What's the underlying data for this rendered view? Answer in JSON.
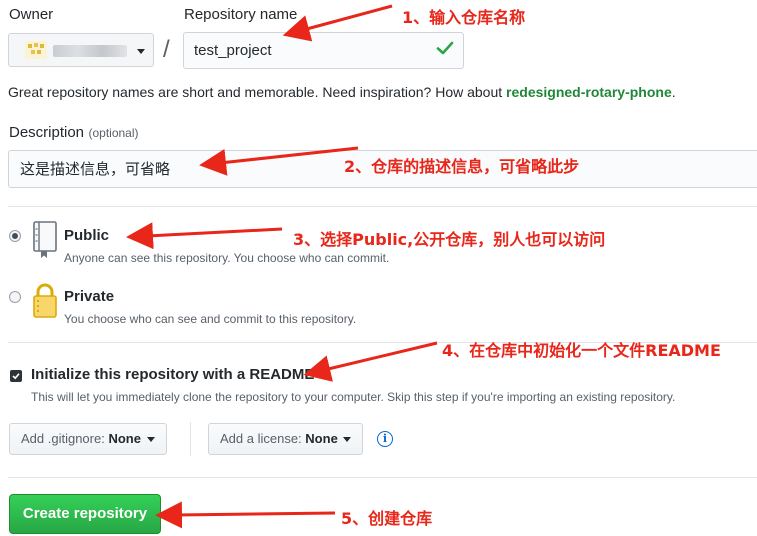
{
  "owner": {
    "label": "Owner"
  },
  "repo": {
    "label": "Repository name",
    "value": "test_project",
    "separator": "/"
  },
  "hint": {
    "text": "Great repository names are short and memorable. Need inspiration? How about ",
    "suggestion": "redesigned-rotary-phone",
    "suffix": "."
  },
  "description": {
    "label": "Description",
    "optional": "(optional)",
    "value": "这是描述信息，可省略"
  },
  "visibility": {
    "public_title": "Public",
    "public_desc": "Anyone can see this repository. You choose who can commit.",
    "private_title": "Private",
    "private_desc": "You choose who can see and commit to this repository."
  },
  "readme": {
    "label": "Initialize this repository with a README",
    "desc": "This will let you immediately clone the repository to your computer. Skip this step if you're importing an existing repository."
  },
  "gitignore": {
    "prefix": "Add .gitignore:",
    "value": "None"
  },
  "license": {
    "prefix": "Add a license:",
    "value": "None"
  },
  "create_button": "Create repository",
  "annotations": {
    "a1": "1、输入仓库名称",
    "a2": "2、仓库的描述信息，可省略此步",
    "a3": "3、选择Public,公开仓库，别人也可以访问",
    "a4": "4、在仓库中初始化一个文件README",
    "a5": "5、创建仓库"
  },
  "colors": {
    "accent_green": "#28a745",
    "suggestion_green": "#22863a",
    "annotation_red": "#e8261a",
    "link_blue": "#0366d6"
  }
}
